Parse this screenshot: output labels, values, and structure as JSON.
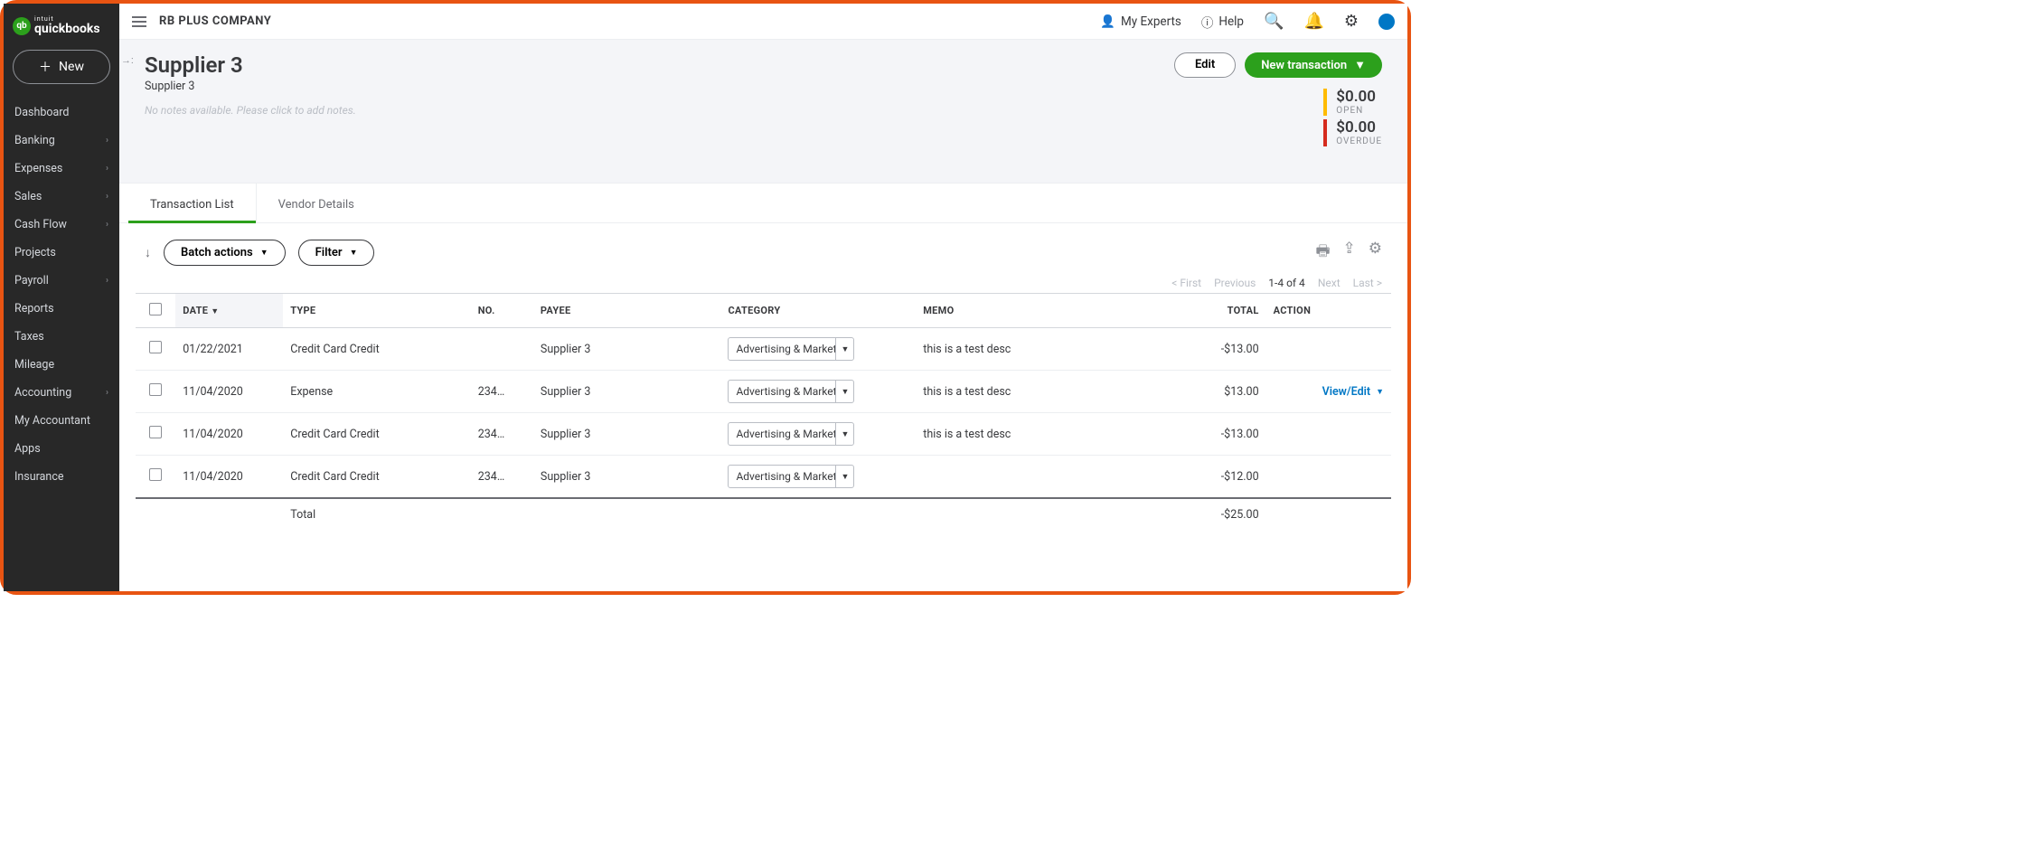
{
  "brand": {
    "intuit": "intuit",
    "product": "quickbooks",
    "badge": "qb"
  },
  "sidebar": {
    "new_label": "New",
    "items": [
      {
        "label": "Dashboard",
        "expandable": false
      },
      {
        "label": "Banking",
        "expandable": true
      },
      {
        "label": "Expenses",
        "expandable": true
      },
      {
        "label": "Sales",
        "expandable": true
      },
      {
        "label": "Cash Flow",
        "expandable": true
      },
      {
        "label": "Projects",
        "expandable": false
      },
      {
        "label": "Payroll",
        "expandable": true
      },
      {
        "label": "Reports",
        "expandable": false
      },
      {
        "label": "Taxes",
        "expandable": false
      },
      {
        "label": "Mileage",
        "expandable": false
      },
      {
        "label": "Accounting",
        "expandable": true
      },
      {
        "label": "My Accountant",
        "expandable": false
      },
      {
        "label": "Apps",
        "expandable": false
      },
      {
        "label": "Insurance",
        "expandable": false
      }
    ]
  },
  "topbar": {
    "company": "RB PLUS COMPANY",
    "experts": "My Experts",
    "help": "Help"
  },
  "header": {
    "title": "Supplier 3",
    "subtitle": "Supplier 3",
    "notes_placeholder": "No notes available. Please click to add notes.",
    "edit": "Edit",
    "new_transaction": "New transaction",
    "open": {
      "amount": "$0.00",
      "label": "OPEN"
    },
    "overdue": {
      "amount": "$0.00",
      "label": "OVERDUE"
    }
  },
  "tabs": [
    {
      "label": "Transaction List",
      "active": true
    },
    {
      "label": "Vendor Details",
      "active": false
    }
  ],
  "toolbar": {
    "batch": "Batch actions",
    "filter": "Filter"
  },
  "pagination": {
    "first": "< First",
    "prev": "Previous",
    "range": "1-4 of 4",
    "next": "Next",
    "last": "Last >"
  },
  "table": {
    "headers": {
      "date": "DATE",
      "type": "TYPE",
      "no": "NO.",
      "payee": "PAYEE",
      "category": "CATEGORY",
      "memo": "MEMO",
      "total": "TOTAL",
      "action": "ACTION"
    },
    "rows": [
      {
        "date": "01/22/2021",
        "type": "Credit Card Credit",
        "no": "",
        "payee": "Supplier 3",
        "category": "Advertising & Marketing",
        "memo": "this is a test desc",
        "total": "-$13.00",
        "action": ""
      },
      {
        "date": "11/04/2020",
        "type": "Expense",
        "no": "234…",
        "payee": "Supplier 3",
        "category": "Advertising & Marketing",
        "memo": "this is a test desc",
        "total": "$13.00",
        "action": "View/Edit"
      },
      {
        "date": "11/04/2020",
        "type": "Credit Card Credit",
        "no": "234…",
        "payee": "Supplier 3",
        "category": "Advertising & Marketing",
        "memo": "this is a test desc",
        "total": "-$13.00",
        "action": ""
      },
      {
        "date": "11/04/2020",
        "type": "Credit Card Credit",
        "no": "234…",
        "payee": "Supplier 3",
        "category": "Advertising & Marketing",
        "memo": "",
        "total": "-$12.00",
        "action": ""
      }
    ],
    "footer": {
      "label": "Total",
      "total": "-$25.00"
    }
  }
}
